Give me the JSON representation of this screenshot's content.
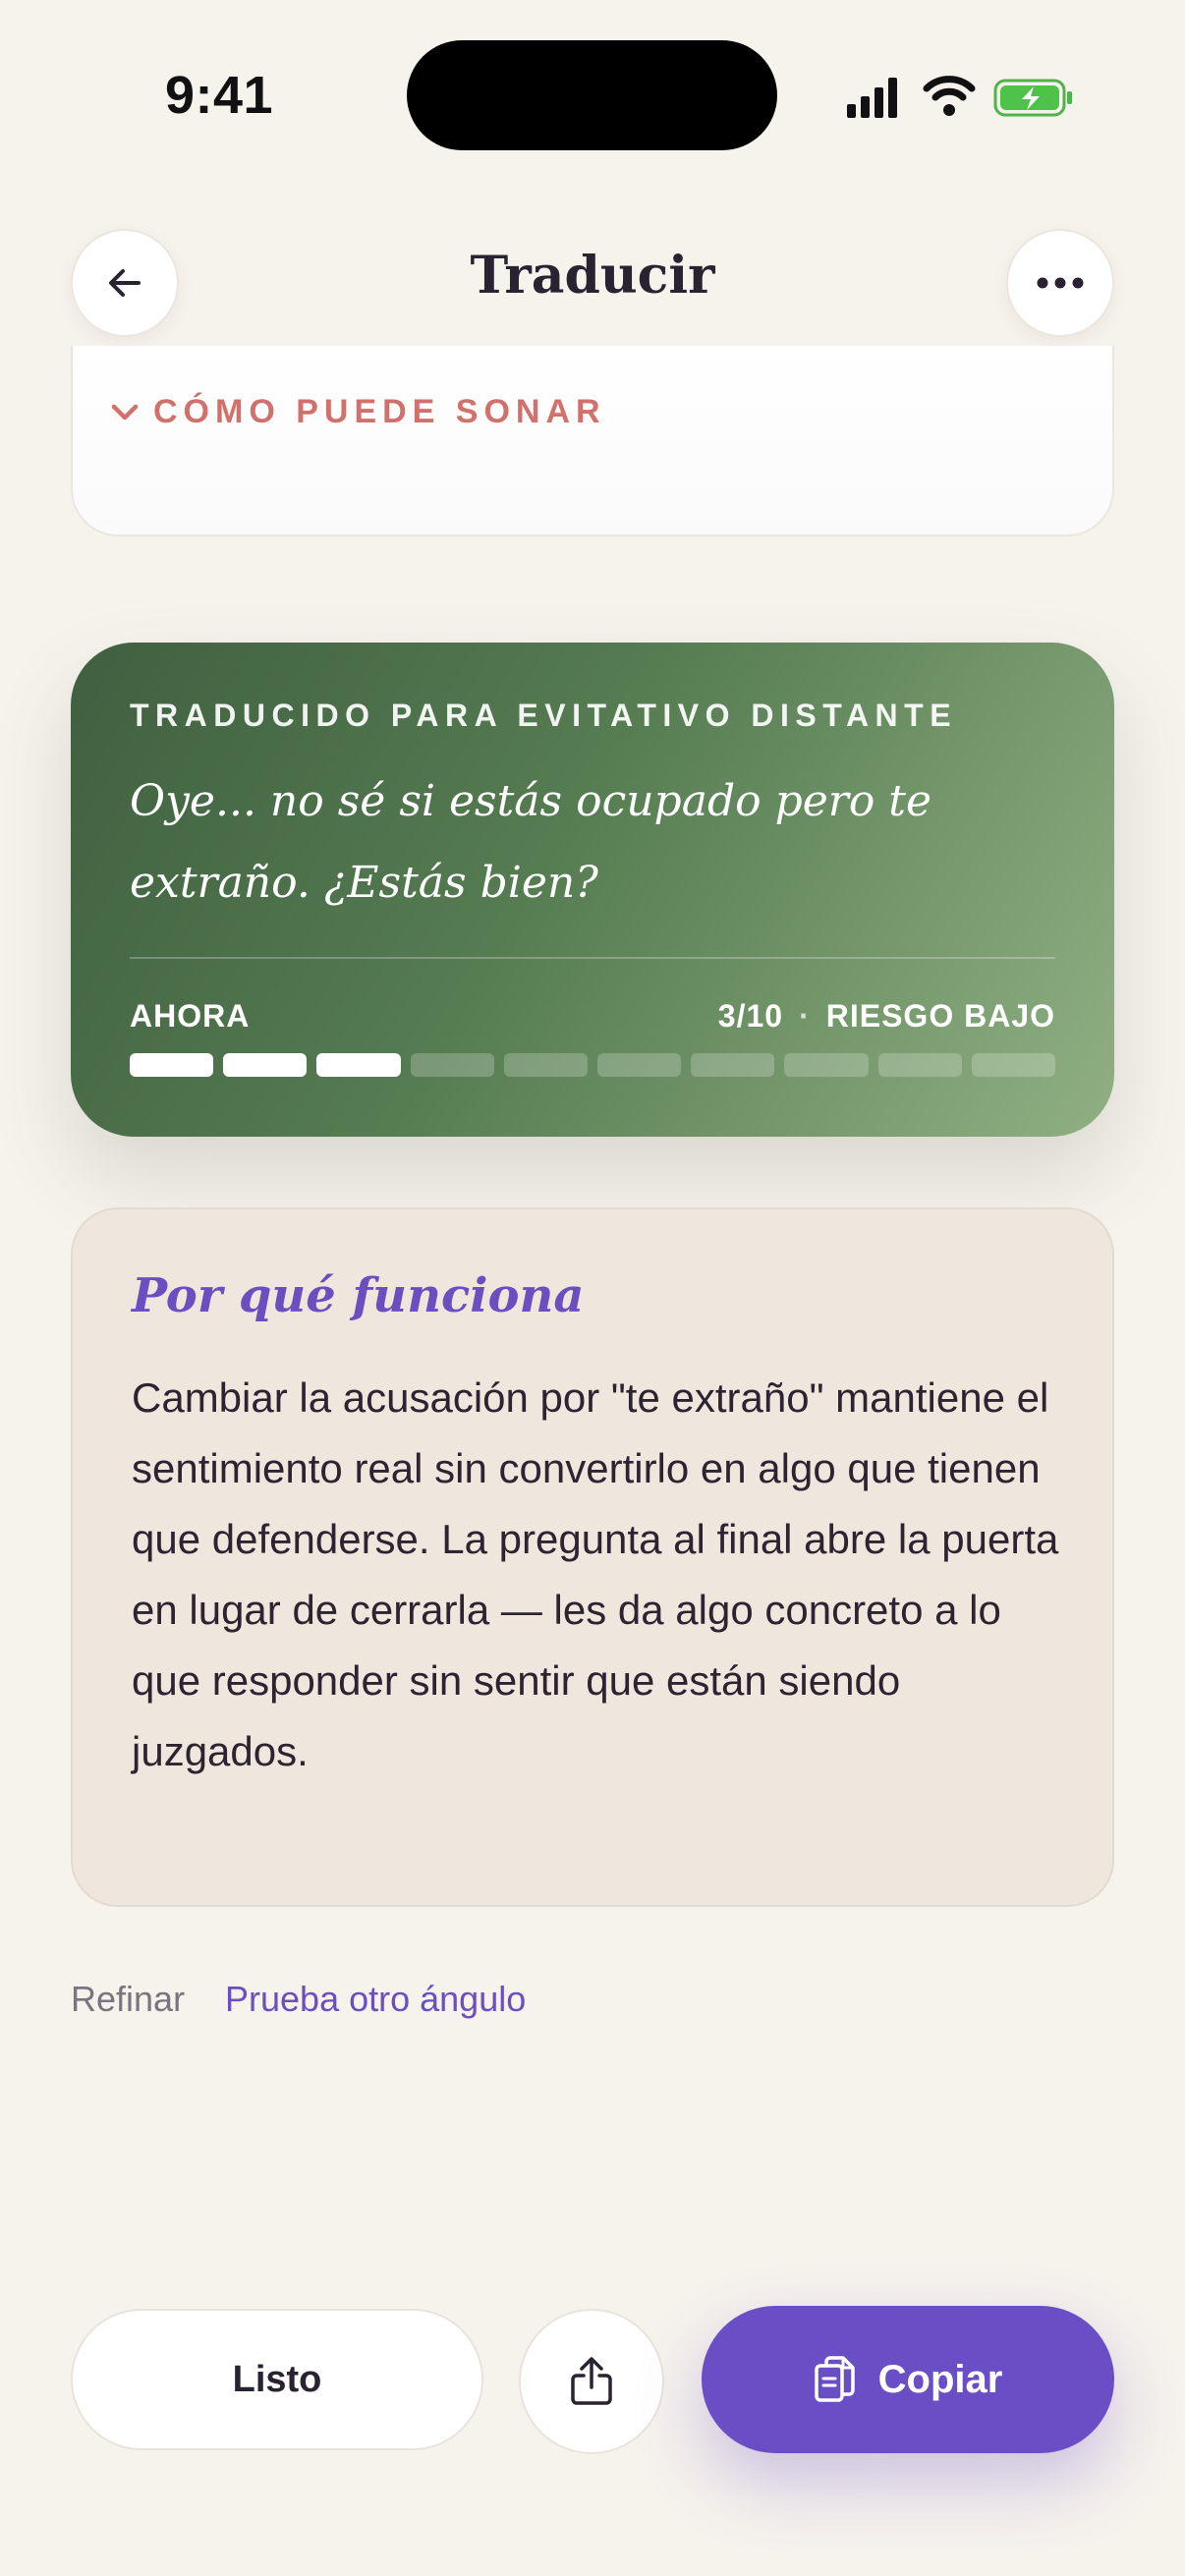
{
  "status_bar": {
    "time": "9:41"
  },
  "header": {
    "title": "Traducir"
  },
  "collapsible": {
    "label": "CÓMO PUEDE SONAR"
  },
  "translation": {
    "kicker": "TRADUCIDO PARA EVITATIVO DISTANTE",
    "quote": "Oye... no sé si estás ocupado pero te extraño. ¿Estás bien?",
    "timing": "AHORA",
    "risk_score": "3/10",
    "separator": "·",
    "risk_label": "RIESGO BAJO",
    "risk_level": 3,
    "risk_max": 10
  },
  "why": {
    "title": "Por qué funciona",
    "body": "Cambiar la acusación por \"te extraño\" mantiene el sentimiento real sin convertirlo en algo que tienen que defenderse. La pregunta al final abre la puerta en lugar de cerrarla — les da algo concreto a lo que responder sin sentir que están siendo juzgados."
  },
  "refine": {
    "label": "Refinar",
    "link": "Prueba otro ángulo"
  },
  "actions": {
    "done": "Listo",
    "copy": "Copiar"
  },
  "colors": {
    "background": "#f6f2ec",
    "accent": "#6a4ec6",
    "coral": "#d2716b",
    "card_green": "#567c52"
  },
  "icons": {
    "back": "arrow-left-icon",
    "more": "more-horizontal-icon",
    "chevron": "chevron-down-icon",
    "share": "share-icon",
    "copy": "copy-icon"
  }
}
